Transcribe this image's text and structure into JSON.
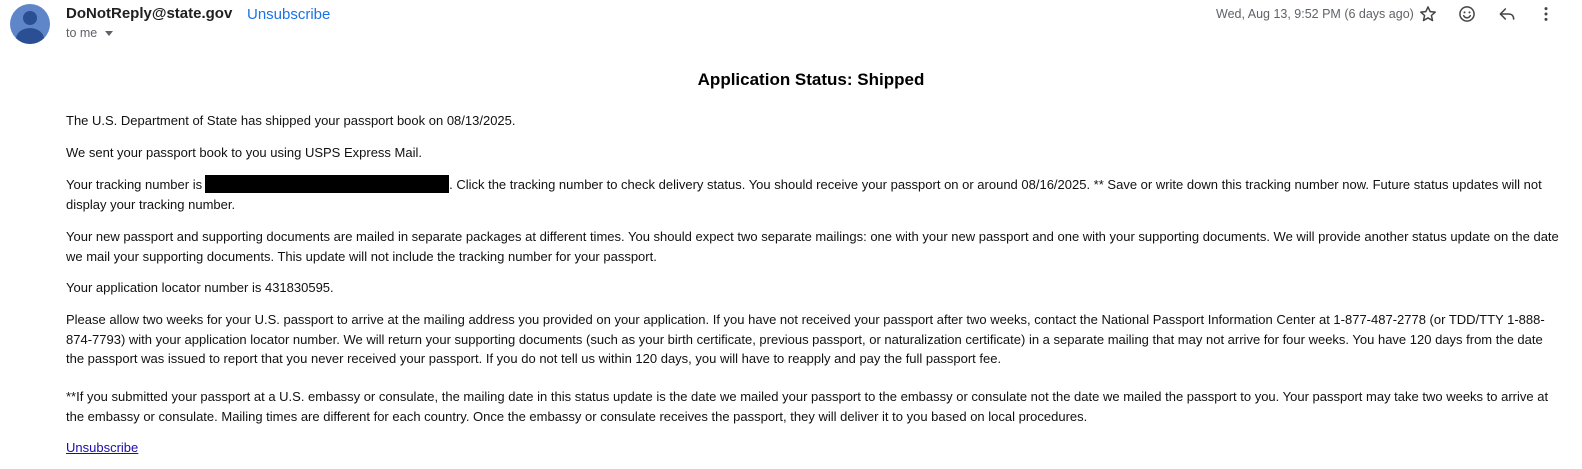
{
  "header": {
    "sender": "DoNotReply@state.gov",
    "unsubscribe": "Unsubscribe",
    "recipient": "to me",
    "date": "Wed, Aug 13, 9:52 PM (6 days ago)",
    "icons": [
      "star-icon",
      "emoji-icon",
      "reply-icon",
      "more-vert-icon"
    ]
  },
  "email": {
    "title": "Application Status: Shipped",
    "p1": "The U.S. Department of State has shipped your passport book on 08/13/2025.",
    "p2": "We sent your passport book to you using USPS Express Mail.",
    "p3_before": "Your tracking number is",
    "p3_after": ". Click the tracking number to check delivery status. You should receive your passport on or around 08/16/2025. ** Save or write down this tracking number now. Future status updates will not display your tracking number.",
    "p4": "Your new passport and supporting documents are mailed in separate packages at different times. You should expect two separate mailings: one with your new passport and one with your supporting documents. We will provide another status update on the date we mail your supporting documents. This update will not include the tracking number for your passport.",
    "p5": "Your application locator number is 431830595.",
    "p6": "Please allow two weeks for your U.S. passport to arrive at the mailing address you provided on your application. If you have not received your passport after two weeks, contact the National Passport Information Center at 1-877-487-2778 (or TDD/TTY 1-888-874-7793) with your application locator number. We will return your supporting documents (such as your birth certificate, previous passport, or naturalization certificate) in a separate mailing that may not arrive for four weeks. You have 120 days from the date the passport was issued to report that you never received your passport. If you do not tell us within 120 days, you will have to reapply and pay the full passport fee.",
    "p7": "**If you submitted your passport at a U.S. embassy or consulate, the mailing date in this status update is the date we mailed your passport to the embassy or consulate not the date we mailed the passport to you. Your passport may take two weeks to arrive at the embassy or consulate. Mailing times are different for each country. Once the embassy or consulate receives the passport, they will deliver it to you based on local procedures.",
    "footer_link": "Unsubscribe"
  },
  "colors": {
    "link": "#1a73e8",
    "avatar_bg": "#5f86c9",
    "avatar_fg": "#2a4f93"
  }
}
